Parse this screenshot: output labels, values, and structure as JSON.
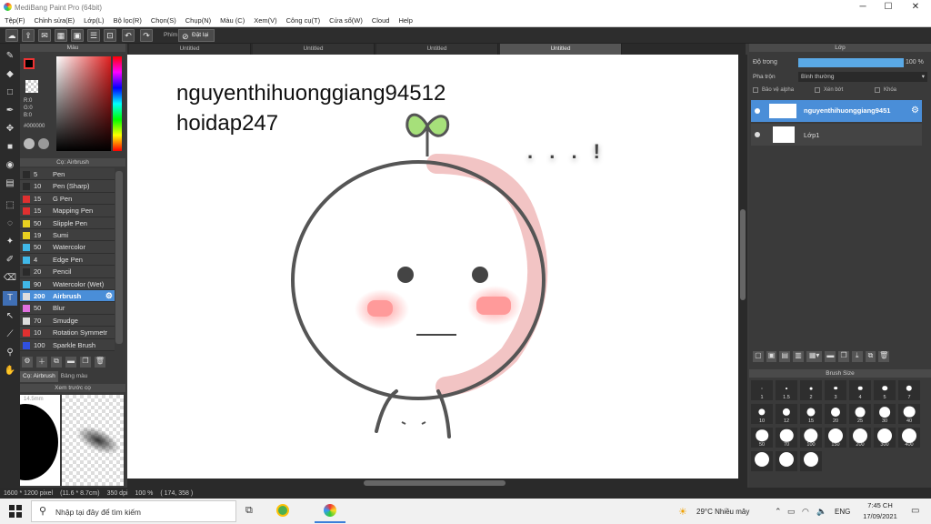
{
  "app": {
    "title": "MediBang Paint Pro (64bit)",
    "window_controls": [
      "─",
      "☐",
      "✕"
    ]
  },
  "menu": [
    "Tệp(F)",
    "Chỉnh sửa(E)",
    "Lớp(L)",
    "Bộ lọc(R)",
    "Chọn(S)",
    "Chụp(N)",
    "Màu (C)",
    "Xem(V)",
    "Công cụ(T)",
    "Cửa sổ(W)",
    "Cloud",
    "Help"
  ],
  "toolbar": {
    "phim_label": "Phím",
    "reset_label": "Đặt lại"
  },
  "color_panel": {
    "title": "Màu",
    "r": "R:0",
    "g": "G:0",
    "b": "B:0",
    "hex": "#000000"
  },
  "brush_panel": {
    "title": "Cọ: Airbrush",
    "items": [
      {
        "size": "5",
        "name": "Pen",
        "color": "#2a2a2a"
      },
      {
        "size": "10",
        "name": "Pen (Sharp)",
        "color": "#2a2a2a"
      },
      {
        "size": "15",
        "name": "G Pen",
        "color": "#e03030"
      },
      {
        "size": "15",
        "name": "Mapping Pen",
        "color": "#e03030"
      },
      {
        "size": "50",
        "name": "Slipple Pen",
        "color": "#e8d020"
      },
      {
        "size": "19",
        "name": "Sumi",
        "color": "#e8d020"
      },
      {
        "size": "50",
        "name": "Watercolor",
        "color": "#40b8e8"
      },
      {
        "size": "4",
        "name": "Edge Pen",
        "color": "#40b8e8"
      },
      {
        "size": "20",
        "name": "Pencil",
        "color": "#2a2a2a"
      },
      {
        "size": "90",
        "name": "Watercolor (Wet)",
        "color": "#40b8e8"
      },
      {
        "size": "200",
        "name": "Airbrush",
        "color": "#dddddd"
      },
      {
        "size": "50",
        "name": "Blur",
        "color": "#e070e0"
      },
      {
        "size": "70",
        "name": "Smudge",
        "color": "#dddddd"
      },
      {
        "size": "10",
        "name": "Rotation Symmetr",
        "color": "#e03030"
      },
      {
        "size": "100",
        "name": "Sparkle Brush",
        "color": "#3050e0"
      }
    ],
    "selected_index": 10,
    "tab_brush": "Cọ: Airbrush",
    "tab_palette": "Bảng màu"
  },
  "preview_panel": {
    "title": "Xem trước cọ",
    "size_label": "14.5mm"
  },
  "doc_tabs": [
    "Untitled",
    "Untitled",
    "Untitled",
    "Untitled"
  ],
  "canvas": {
    "text_line1": "nguyenthihuonggiang94512",
    "text_line2": "hoidap247",
    "dots_text": ". . . !"
  },
  "layer_panel": {
    "title": "Lớp",
    "opacity_label": "Độ trong",
    "opacity_value": "100 %",
    "opacity_fraction": 1.0,
    "blend_label": "Pha trộn",
    "blend_value": "Bình thường",
    "protect_alpha": "Bảo vệ alpha",
    "clip": "Xén bớt",
    "lock": "Khóa",
    "layers": [
      {
        "name": "nguyenthihuonggiang9451"
      },
      {
        "name": "Lớp1"
      }
    ]
  },
  "brush_size_panel": {
    "title": "Brush Size",
    "sizes": [
      "1",
      "1.5",
      "2",
      "3",
      "4",
      "5",
      "7",
      "10",
      "12",
      "15",
      "20",
      "25",
      "30",
      "40",
      "50",
      "70",
      "100",
      "150",
      "200",
      "300",
      "400",
      "",
      "",
      ""
    ]
  },
  "status": {
    "dimensions": "1600 * 1200 pixel",
    "physical": "(11.6 * 8.7cm)",
    "dpi": "350 dpi",
    "zoom": "100 %",
    "coords": "( 174, 358 )"
  },
  "taskbar": {
    "search_placeholder": "Nhập tại đây để tìm kiếm",
    "weather": "29°C  Nhiều mây",
    "lang": "ENG",
    "time": "7:45 CH",
    "date": "17/09/2021"
  },
  "colors": {
    "accent": "#4a8ed8",
    "blush": "#ff8f8f",
    "sprout": "#a6e07a",
    "outline": "#555555"
  }
}
